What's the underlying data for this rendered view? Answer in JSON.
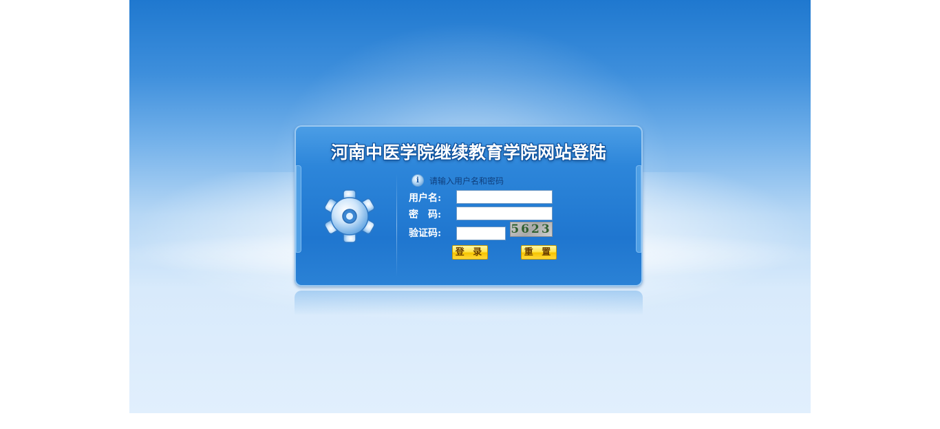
{
  "login": {
    "title": "河南中医学院继续教育学院网站登陆",
    "hint": "请输入用户名和密码",
    "labels": {
      "username": "用户名:",
      "password": "密　码:",
      "captcha": "验证码:"
    },
    "fields": {
      "username_value": "",
      "password_value": "",
      "captcha_value": ""
    },
    "captcha_text": "5623",
    "buttons": {
      "login": "登 录",
      "reset": "重 置"
    }
  },
  "icons": [
    "gear-icon",
    "info-icon"
  ],
  "colors": {
    "background_top": "#1f78cf",
    "background_bottom": "#e1effd",
    "panel": "#2d86da",
    "button": "#ffe44d"
  }
}
